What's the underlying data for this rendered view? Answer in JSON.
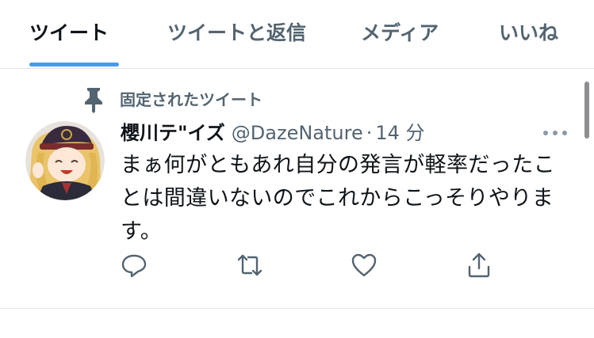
{
  "tabs": [
    {
      "label": "ツイート",
      "active": true
    },
    {
      "label": "ツイートと返信",
      "active": false
    },
    {
      "label": "メディア",
      "active": false
    },
    {
      "label": "いいね",
      "active": false
    }
  ],
  "pinned": {
    "label": "固定されたツイート",
    "icon": "pin-icon"
  },
  "tweet": {
    "display_name": "櫻川テ\"イズ",
    "handle": "@DazeNature",
    "separator": "·",
    "time": "14 分",
    "text": "まぁ何がともあれ自分の発言が軽率だったことは間違いないのでこれからこっそりやります。",
    "more_icon": "more-options-icon"
  },
  "actions": [
    {
      "name": "reply-icon"
    },
    {
      "name": "retweet-icon"
    },
    {
      "name": "like-icon"
    },
    {
      "name": "share-icon"
    }
  ],
  "colors": {
    "accent": "#4a99e9",
    "text_primary": "#0f1419",
    "text_secondary": "#536471",
    "divider": "#e1e6ea"
  }
}
